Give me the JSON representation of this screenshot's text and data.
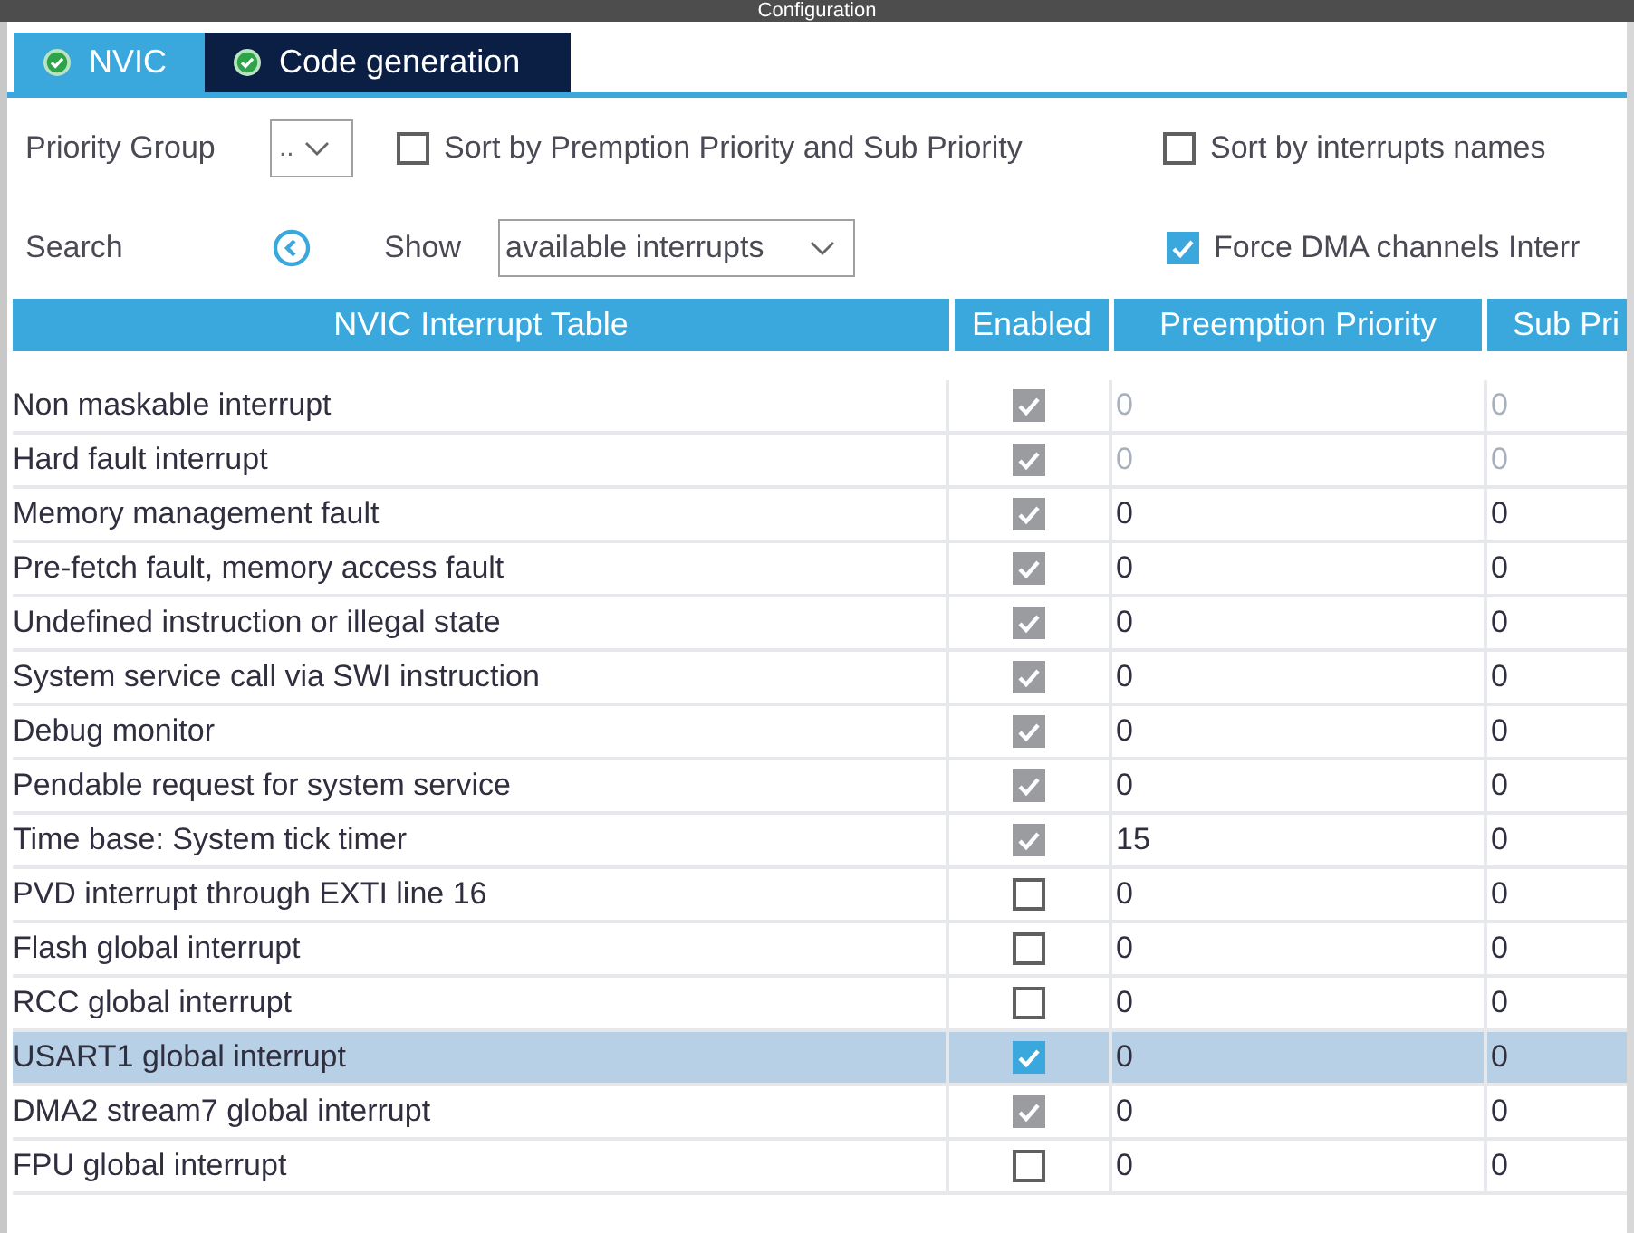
{
  "window": {
    "title": "Configuration"
  },
  "tabs": [
    {
      "label": "NVIC",
      "selected": true
    },
    {
      "label": "Code generation",
      "selected": false
    }
  ],
  "priority_group": {
    "label": "Priority Group",
    "value": ".."
  },
  "sort_options": [
    {
      "label": "Sort by Premption Priority and Sub Priority",
      "checked": false
    },
    {
      "label": "Sort by interrupts names",
      "checked": false
    }
  ],
  "search": {
    "label": "Search"
  },
  "show": {
    "label": "Show",
    "value": "available interrupts"
  },
  "force_dma": {
    "label": "Force DMA channels Interr",
    "checked": true
  },
  "table": {
    "columns": [
      "NVIC Interrupt Table",
      "Enabled",
      "Preemption Priority",
      "Sub Pri"
    ],
    "rows": [
      {
        "name": "Non maskable interrupt",
        "enabled": true,
        "disabled": true,
        "preemption": "0",
        "sub": "0",
        "priority_locked": true,
        "selected": false
      },
      {
        "name": "Hard fault interrupt",
        "enabled": true,
        "disabled": true,
        "preemption": "0",
        "sub": "0",
        "priority_locked": true,
        "selected": false
      },
      {
        "name": "Memory management fault",
        "enabled": true,
        "disabled": true,
        "preemption": "0",
        "sub": "0",
        "priority_locked": false,
        "selected": false
      },
      {
        "name": "Pre-fetch fault, memory access fault",
        "enabled": true,
        "disabled": true,
        "preemption": "0",
        "sub": "0",
        "priority_locked": false,
        "selected": false
      },
      {
        "name": "Undefined instruction or illegal state",
        "enabled": true,
        "disabled": true,
        "preemption": "0",
        "sub": "0",
        "priority_locked": false,
        "selected": false
      },
      {
        "name": "System service call via SWI instruction",
        "enabled": true,
        "disabled": true,
        "preemption": "0",
        "sub": "0",
        "priority_locked": false,
        "selected": false
      },
      {
        "name": "Debug monitor",
        "enabled": true,
        "disabled": true,
        "preemption": "0",
        "sub": "0",
        "priority_locked": false,
        "selected": false
      },
      {
        "name": "Pendable request for system service",
        "enabled": true,
        "disabled": true,
        "preemption": "0",
        "sub": "0",
        "priority_locked": false,
        "selected": false
      },
      {
        "name": "Time base: System tick timer",
        "enabled": true,
        "disabled": true,
        "preemption": "15",
        "sub": "0",
        "priority_locked": false,
        "selected": false
      },
      {
        "name": "PVD interrupt through EXTI line 16",
        "enabled": false,
        "disabled": false,
        "preemption": "0",
        "sub": "0",
        "priority_locked": false,
        "selected": false
      },
      {
        "name": "Flash global interrupt",
        "enabled": false,
        "disabled": false,
        "preemption": "0",
        "sub": "0",
        "priority_locked": false,
        "selected": false
      },
      {
        "name": "RCC global interrupt",
        "enabled": false,
        "disabled": false,
        "preemption": "0",
        "sub": "0",
        "priority_locked": false,
        "selected": false
      },
      {
        "name": "USART1 global interrupt",
        "enabled": true,
        "disabled": false,
        "preemption": "0",
        "sub": "0",
        "priority_locked": false,
        "selected": true
      },
      {
        "name": "DMA2 stream7 global interrupt",
        "enabled": true,
        "disabled": true,
        "preemption": "0",
        "sub": "0",
        "priority_locked": false,
        "selected": false
      },
      {
        "name": "FPU global interrupt",
        "enabled": false,
        "disabled": false,
        "preemption": "0",
        "sub": "0",
        "priority_locked": false,
        "selected": false
      }
    ]
  }
}
